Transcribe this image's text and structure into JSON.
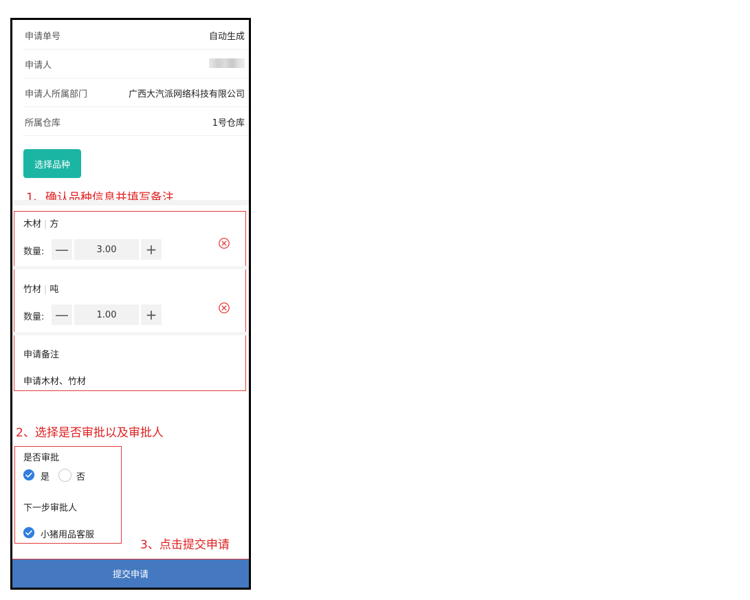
{
  "form": {
    "rows": [
      {
        "label": "申请单号",
        "value": "自动生成"
      },
      {
        "label": "申请人",
        "value": ""
      },
      {
        "label": "申请人所属部门",
        "value": "广西大汽派网络科技有限公司"
      },
      {
        "label": "所属仓库",
        "value": "1号仓库"
      }
    ],
    "select_variety_button": "选择品种"
  },
  "annotations": {
    "step1": "1、确认品种信息并填写备注",
    "step2": "2、选择是否审批以及审批人",
    "step3": "3、点击提交申请"
  },
  "items": [
    {
      "name": "木材",
      "unit": "方",
      "qty_label": "数量:",
      "qty": "3.00"
    },
    {
      "name": "竹材",
      "unit": "吨",
      "qty_label": "数量:",
      "qty": "1.00"
    }
  ],
  "stepper": {
    "minus": "—",
    "plus": "+"
  },
  "remark": {
    "label": "申请备注",
    "value": "申请木材、竹材"
  },
  "approval": {
    "label": "是否审批",
    "options": [
      "是",
      "否"
    ],
    "selected": "是",
    "next_label": "下一步审批人",
    "approver": "小猪用品客服"
  },
  "submit": {
    "label": "提交申请"
  },
  "colors": {
    "accent": "#1bb5a4",
    "submit": "#4479c1",
    "annotation": "#e02020",
    "check": "#2f7ee0"
  },
  "icons": {
    "delete": "circle-x-icon",
    "check": "check-circle-icon"
  }
}
